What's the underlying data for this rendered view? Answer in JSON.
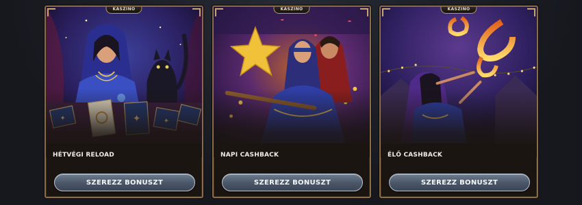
{
  "colors": {
    "card_border": "#8a6d48",
    "button_top": "#6d7c8e",
    "button_bottom": "#3b4555",
    "page_bg": "#1a1d24"
  },
  "cards": [
    {
      "tag": "KASZINO",
      "title": "HÉTVÉGI RELOAD",
      "button_label": "SZEREZZ BONUSZT",
      "art": "fortune-teller-with-cat-and-tarot-cards"
    },
    {
      "tag": "KASZINO",
      "title": "NAPI CASHBACK",
      "button_label": "SZEREZZ BONUSZT",
      "art": "blindfolded-woman-with-pinata-star"
    },
    {
      "tag": "KASZINO",
      "title": "ÉLŐ CASHBACK",
      "button_label": "SZEREZZ BONUSZT",
      "art": "fire-breathing-performer"
    }
  ]
}
